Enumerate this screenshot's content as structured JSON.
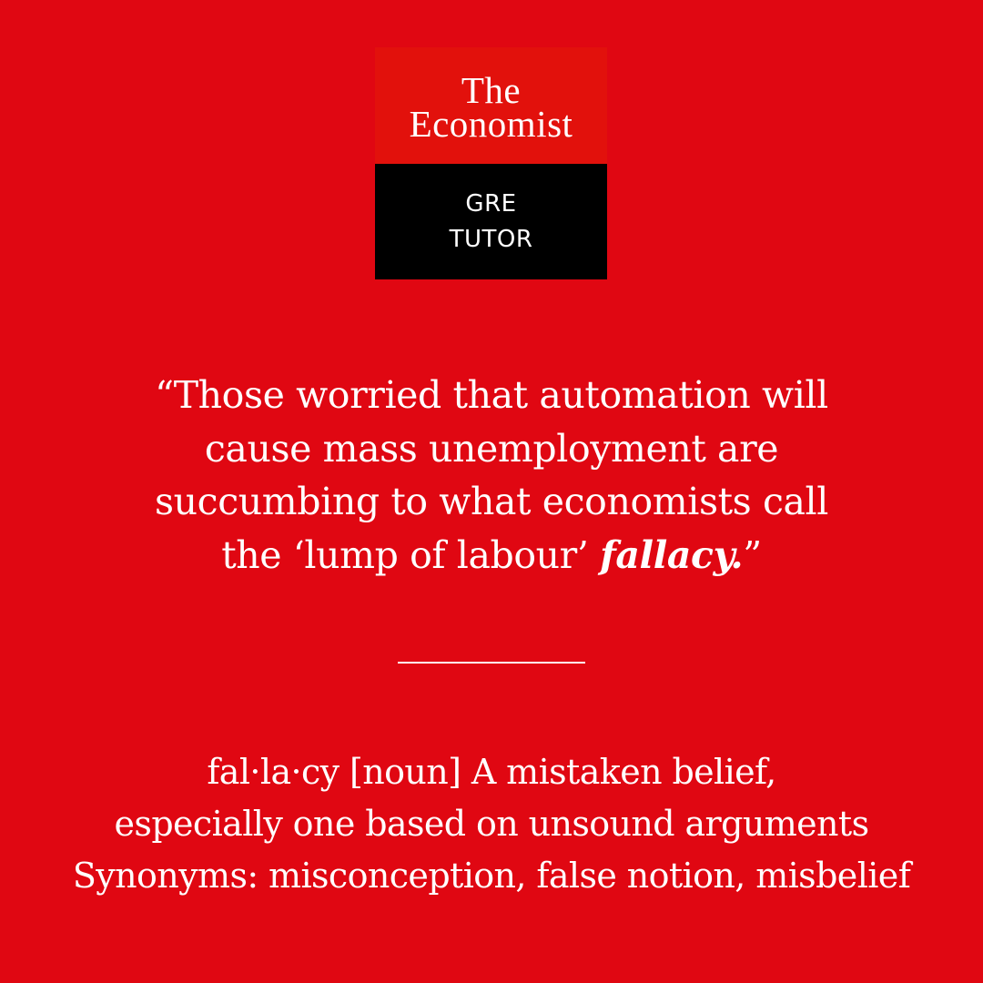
{
  "logo": {
    "brand_line1": "The",
    "brand_line2": "Economist",
    "product_line1": "GRE",
    "product_line2": "TUTOR"
  },
  "quote": {
    "line1": "“Those worried that automation will",
    "line2": "cause mass unemployment are",
    "line3": "succumbing to what economists call",
    "line4_prefix": "the ‘lump of labour’ ",
    "line4_term": "fallacy.",
    "line4_suffix": "”"
  },
  "definition": {
    "line1": "fal·la·cy [noun] A mistaken belief,",
    "line2": "especially one based on unsound arguments",
    "line3": "Synonyms: misconception, false notion, misbelief"
  },
  "colors": {
    "background": "#e00712",
    "logo_red": "#e2110c",
    "logo_black": "#000000",
    "text": "#ffffff"
  }
}
